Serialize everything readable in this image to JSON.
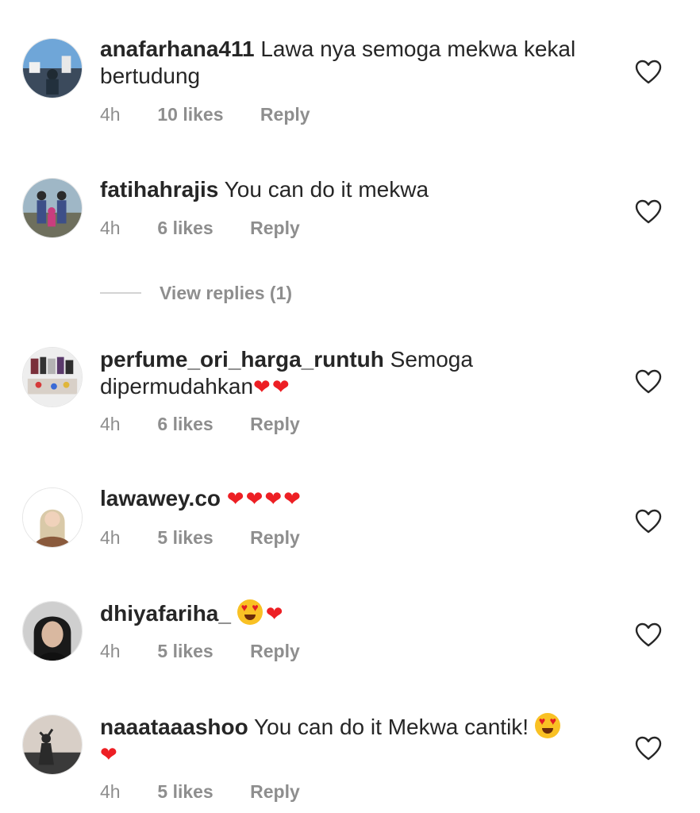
{
  "comments": [
    {
      "username": "anafarhana411",
      "text": "Lawa nya semoga mekwa kekal bertudung",
      "emoji": "",
      "time": "4h",
      "likes": "10 likes",
      "reply": "Reply"
    },
    {
      "username": "fatihahrajis",
      "text": "You can do it mekwa",
      "emoji": "",
      "time": "4h",
      "likes": "6 likes",
      "reply": "Reply"
    },
    {
      "username": "perfume_ori_harga_runtuh",
      "text": "Semoga dipermudahkan",
      "emoji": "❤❤",
      "time": "4h",
      "likes": "6 likes",
      "reply": "Reply"
    },
    {
      "username": "lawawey.co",
      "text": "",
      "emoji": "❤❤❤❤",
      "time": "4h",
      "likes": "5 likes",
      "reply": "Reply"
    },
    {
      "username": "dhiyafariha_",
      "text": "",
      "emoji": "❤",
      "time": "4h",
      "likes": "5 likes",
      "reply": "Reply"
    },
    {
      "username": "naaataaashoo",
      "text": "You can do it Mekwa cantik!",
      "emoji": "❤",
      "time": "4h",
      "likes": "5 likes",
      "reply": "Reply"
    }
  ],
  "view_replies": {
    "label": "View replies (1)"
  },
  "icons": {
    "like": "heart-outline-icon",
    "emoji_heart": "red-heart-emoji",
    "emoji_face": "heart-eyes-emoji"
  },
  "colors": {
    "text": "#262626",
    "meta": "#8e8e8e",
    "heart": "#ed1f24",
    "divider": "#d3d3d3"
  }
}
